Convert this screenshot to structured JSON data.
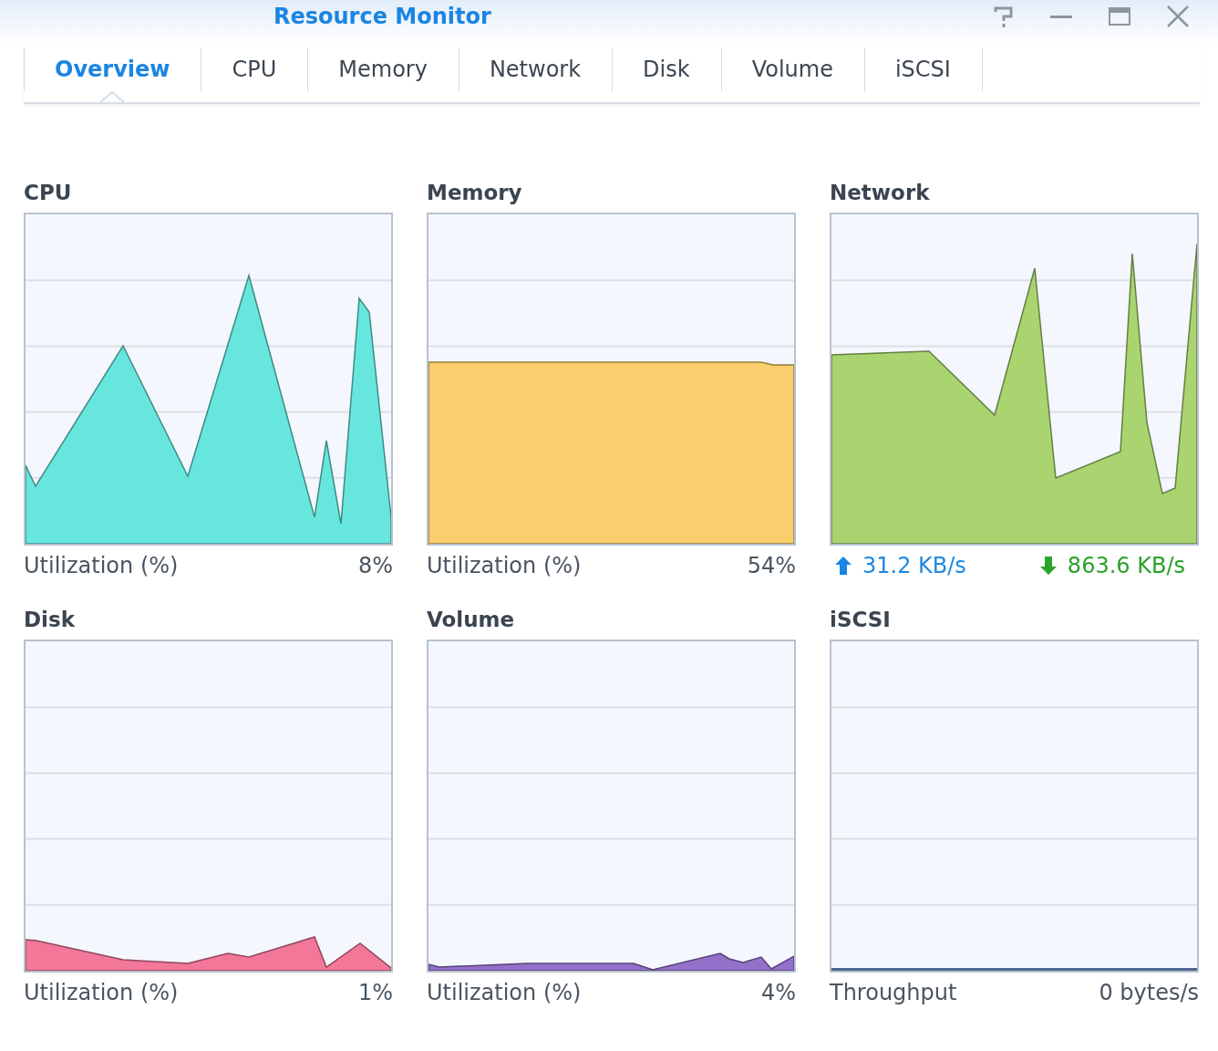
{
  "window": {
    "title": "Resource Monitor"
  },
  "tabs": [
    {
      "label": "Overview",
      "selected": true
    },
    {
      "label": "CPU",
      "selected": false
    },
    {
      "label": "Memory",
      "selected": false
    },
    {
      "label": "Network",
      "selected": false
    },
    {
      "label": "Disk",
      "selected": false
    },
    {
      "label": "Volume",
      "selected": false
    },
    {
      "label": "iSCSI",
      "selected": false
    }
  ],
  "panels": [
    {
      "title": "CPU",
      "kind": "utilization",
      "color": "#67e6dd",
      "caption": "Utilization (%)",
      "value": "8%"
    },
    {
      "title": "Memory",
      "kind": "utilization",
      "color": "#f8cf6c",
      "caption": "Utilization (%)",
      "value": "54%"
    },
    {
      "title": "Network",
      "kind": "network",
      "color": "#a9d46f",
      "upload": "31.2 KB/s",
      "download": "863.6 KB/s"
    },
    {
      "title": "Disk",
      "kind": "utilization",
      "color": "#f27799",
      "caption": "Utilization (%)",
      "value": "1%"
    },
    {
      "title": "Volume",
      "kind": "utilization",
      "color": "#9370c9",
      "caption": "Utilization (%)",
      "value": "4%"
    },
    {
      "title": "iSCSI",
      "kind": "throughput",
      "color": "#4d6890",
      "caption": "Throughput",
      "value": "0 bytes/s"
    }
  ]
}
